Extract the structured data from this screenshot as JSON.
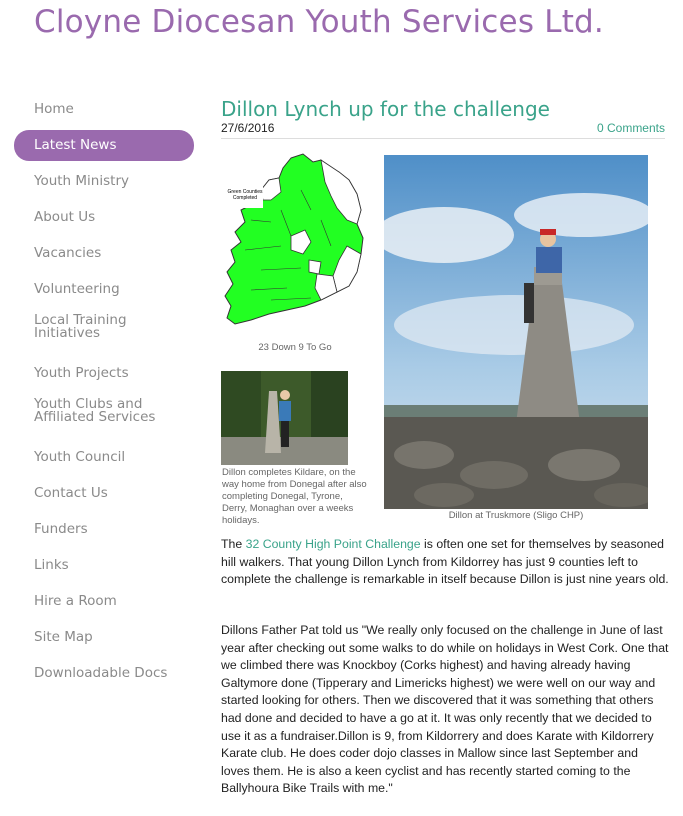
{
  "site": {
    "title": "Cloyne Diocesan Youth Services Ltd."
  },
  "nav": {
    "items": [
      {
        "label": "Home"
      },
      {
        "label": "Latest News",
        "active": true
      },
      {
        "label": "Youth Ministry"
      },
      {
        "label": "About Us"
      },
      {
        "label": "Vacancies"
      },
      {
        "label": "Volunteering"
      },
      {
        "label": "Local Training Initiatives"
      },
      {
        "label": "Youth Projects"
      },
      {
        "label": "Youth Clubs and Affiliated Services"
      },
      {
        "label": "Youth Council"
      },
      {
        "label": "Contact Us"
      },
      {
        "label": "Funders"
      },
      {
        "label": "Links"
      },
      {
        "label": "Hire a Room"
      },
      {
        "label": "Site Map"
      },
      {
        "label": "Downloadable Docs"
      }
    ]
  },
  "post": {
    "title": "Dillon Lynch up for the challenge",
    "date": "27/6/2016",
    "comments": "0 Comments",
    "map": {
      "legend_text": "Green Counties Completed",
      "caption": "23 Down 9 To Go",
      "color_done": "#22ff22"
    },
    "photo_small": {
      "caption": "Dillon completes Kildare, on the way home from Donegal after also completing Donegal, Tyrone, Derry, Monaghan over a weeks holidays."
    },
    "photo_large": {
      "caption": "Dillon at Truskmore (Sligo CHP)"
    },
    "para1": {
      "before": "The ",
      "link": "32 County High Point Challenge",
      "after": " is often one set for themselves by seasoned hill walkers. That young Dillon Lynch from Kildorrey has just 9 counties left to complete the challenge is remarkable in itself because Dillon is just nine years old."
    },
    "para2": "Dillons Father Pat told us \"We really only focused on the challenge in June of last year after checking out some walks to do while on holidays in West Cork. One that we climbed there was Knockboy (Corks highest) and having already having Galtymore done (Tipperary and Limericks highest) we were well on our way and started looking for others. Then we discovered that it was something that others had done and decided to have a go at it. It was only recently that we decided to use it as a fundraiser.Dillon is 9, from Kildorrery and does Karate with Kildorrery Karate club. He does coder dojo classes in Mallow since last September and loves them. He is also a keen cyclist and has recently started coming to the Ballyhoura Bike Trails with me.\""
  },
  "colors": {
    "brand": "#9a6aae",
    "accent": "#3aa38a"
  }
}
